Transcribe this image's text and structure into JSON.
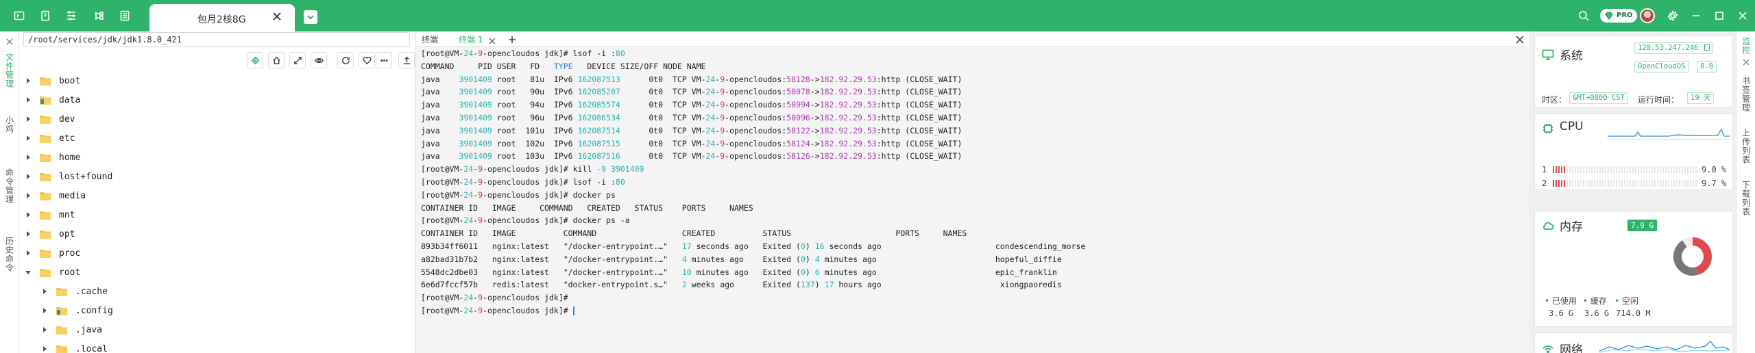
{
  "topbar": {
    "left_icons": [
      "terminal-icon",
      "file-icon",
      "network-icon",
      "tree-icon",
      "list-icon"
    ],
    "active_tab": "包月2核8G",
    "pro_label": "PRO",
    "right_icons": [
      "search-icon",
      "settings-icon",
      "minimize-icon",
      "maximize-icon",
      "close-icon"
    ]
  },
  "left_tabs": [
    "文件管理",
    "小鸡",
    "命令管理",
    "历史命令"
  ],
  "file_panel": {
    "path": "/root/services/jdk/jdk1.8.0_421",
    "toolbar_icons": [
      "locate-icon",
      "home-icon",
      "expand-icon",
      "eye-icon",
      "refresh-icon",
      "heart-icon",
      "more-icon",
      "upload-icon"
    ],
    "tree": [
      {
        "name": "boot",
        "level": 0,
        "expanded": false,
        "special": false
      },
      {
        "name": "data",
        "level": 0,
        "expanded": false,
        "special": true
      },
      {
        "name": "dev",
        "level": 0,
        "expanded": false,
        "special": false
      },
      {
        "name": "etc",
        "level": 0,
        "expanded": false,
        "special": false
      },
      {
        "name": "home",
        "level": 0,
        "expanded": false,
        "special": false
      },
      {
        "name": "lost+found",
        "level": 0,
        "expanded": false,
        "special": false
      },
      {
        "name": "media",
        "level": 0,
        "expanded": false,
        "special": false
      },
      {
        "name": "mnt",
        "level": 0,
        "expanded": false,
        "special": false
      },
      {
        "name": "opt",
        "level": 0,
        "expanded": false,
        "special": false
      },
      {
        "name": "proc",
        "level": 0,
        "expanded": false,
        "special": false
      },
      {
        "name": "root",
        "level": 0,
        "expanded": true,
        "special": false
      },
      {
        "name": ".cache",
        "level": 1,
        "expanded": false,
        "special": false
      },
      {
        "name": ".config",
        "level": 1,
        "expanded": false,
        "special": true
      },
      {
        "name": ".java",
        "level": 1,
        "expanded": false,
        "special": false
      },
      {
        "name": ".local",
        "level": 1,
        "expanded": false,
        "special": false
      }
    ]
  },
  "terminal": {
    "tabs": [
      {
        "label": "终端",
        "active": false
      },
      {
        "label": "终端 1",
        "active": true
      }
    ],
    "lines": [
      [
        [
          "[root@VM-",
          ""
        ],
        [
          "24",
          "num"
        ],
        [
          "-",
          ""
        ],
        [
          "9",
          "red"
        ],
        [
          "-opencloudos jdk]# lsof -i :",
          ""
        ],
        [
          "80",
          "num"
        ]
      ],
      [
        [
          "COMMAND     PID USER   FD   ",
          ""
        ],
        [
          "TYPE",
          "hdr"
        ],
        [
          "   DEVICE SIZE/OFF NODE NAME",
          ""
        ]
      ],
      [
        [
          "java    ",
          ""
        ],
        [
          "3901409",
          "num"
        ],
        [
          " root   81u  IPv6 ",
          ""
        ],
        [
          "162087513",
          "num"
        ],
        [
          "      0t0  TCP VM-",
          ""
        ],
        [
          "24",
          "num"
        ],
        [
          "-",
          ""
        ],
        [
          "9",
          "red"
        ],
        [
          "-opencloudos:",
          ""
        ],
        [
          "58128",
          "ip"
        ],
        [
          "->",
          ""
        ],
        [
          "182.92.29.53",
          "ip"
        ],
        [
          ":http (CLOSE_WAIT)",
          ""
        ]
      ],
      [
        [
          "java    ",
          ""
        ],
        [
          "3901409",
          "num"
        ],
        [
          " root   90u  IPv6 ",
          ""
        ],
        [
          "162085287",
          "num"
        ],
        [
          "      0t0  TCP VM-",
          ""
        ],
        [
          "24",
          "num"
        ],
        [
          "-",
          ""
        ],
        [
          "9",
          "red"
        ],
        [
          "-opencloudos:",
          ""
        ],
        [
          "58078",
          "ip"
        ],
        [
          "->",
          ""
        ],
        [
          "182.92.29.53",
          "ip"
        ],
        [
          ":http (CLOSE_WAIT)",
          ""
        ]
      ],
      [
        [
          "java    ",
          ""
        ],
        [
          "3901409",
          "num"
        ],
        [
          " root   94u  IPv6 ",
          ""
        ],
        [
          "162085574",
          "num"
        ],
        [
          "      0t0  TCP VM-",
          ""
        ],
        [
          "24",
          "num"
        ],
        [
          "-",
          ""
        ],
        [
          "9",
          "red"
        ],
        [
          "-opencloudos:",
          ""
        ],
        [
          "58094",
          "ip"
        ],
        [
          "->",
          ""
        ],
        [
          "182.92.29.53",
          "ip"
        ],
        [
          ":http (CLOSE_WAIT)",
          ""
        ]
      ],
      [
        [
          "java    ",
          ""
        ],
        [
          "3901409",
          "num"
        ],
        [
          " root   96u  IPv6 ",
          ""
        ],
        [
          "162086534",
          "num"
        ],
        [
          "      0t0  TCP VM-",
          ""
        ],
        [
          "24",
          "num"
        ],
        [
          "-",
          ""
        ],
        [
          "9",
          "red"
        ],
        [
          "-opencloudos:",
          ""
        ],
        [
          "58096",
          "ip"
        ],
        [
          "->",
          ""
        ],
        [
          "182.92.29.53",
          "ip"
        ],
        [
          ":http (CLOSE_WAIT)",
          ""
        ]
      ],
      [
        [
          "java    ",
          ""
        ],
        [
          "3901409",
          "num"
        ],
        [
          " root  101u  IPv6 ",
          ""
        ],
        [
          "162087514",
          "num"
        ],
        [
          "      0t0  TCP VM-",
          ""
        ],
        [
          "24",
          "num"
        ],
        [
          "-",
          ""
        ],
        [
          "9",
          "red"
        ],
        [
          "-opencloudos:",
          ""
        ],
        [
          "58122",
          "ip"
        ],
        [
          "->",
          ""
        ],
        [
          "182.92.29.53",
          "ip"
        ],
        [
          ":http (CLOSE_WAIT)",
          ""
        ]
      ],
      [
        [
          "java    ",
          ""
        ],
        [
          "3901409",
          "num"
        ],
        [
          " root  102u  IPv6 ",
          ""
        ],
        [
          "162087515",
          "num"
        ],
        [
          "      0t0  TCP VM-",
          ""
        ],
        [
          "24",
          "num"
        ],
        [
          "-",
          ""
        ],
        [
          "9",
          "red"
        ],
        [
          "-opencloudos:",
          ""
        ],
        [
          "58124",
          "ip"
        ],
        [
          "->",
          ""
        ],
        [
          "182.92.29.53",
          "ip"
        ],
        [
          ":http (CLOSE_WAIT)",
          ""
        ]
      ],
      [
        [
          "java    ",
          ""
        ],
        [
          "3901409",
          "num"
        ],
        [
          " root  103u  IPv6 ",
          ""
        ],
        [
          "162087516",
          "num"
        ],
        [
          "      0t0  TCP VM-",
          ""
        ],
        [
          "24",
          "num"
        ],
        [
          "-",
          ""
        ],
        [
          "9",
          "red"
        ],
        [
          "-opencloudos:",
          ""
        ],
        [
          "58126",
          "ip"
        ],
        [
          "->",
          ""
        ],
        [
          "182.92.29.53",
          "ip"
        ],
        [
          ":http (CLOSE_WAIT)",
          ""
        ]
      ],
      [
        [
          "[root@VM-",
          ""
        ],
        [
          "24",
          "num"
        ],
        [
          "-",
          ""
        ],
        [
          "9",
          "red"
        ],
        [
          "-opencloudos jdk]# kill ",
          ""
        ],
        [
          "-9",
          "num"
        ],
        [
          " ",
          ""
        ],
        [
          "3901409",
          "num"
        ]
      ],
      [
        [
          "[root@VM-",
          ""
        ],
        [
          "24",
          "num"
        ],
        [
          "-",
          ""
        ],
        [
          "9",
          "red"
        ],
        [
          "-opencloudos jdk]# lsof -i :",
          ""
        ],
        [
          "80",
          "num"
        ]
      ],
      [
        [
          "[root@VM-",
          ""
        ],
        [
          "24",
          "num"
        ],
        [
          "-",
          ""
        ],
        [
          "9",
          "red"
        ],
        [
          "-opencloudos jdk]# docker ps",
          ""
        ]
      ],
      [
        [
          "CONTAINER ID   IMAGE     COMMAND   CREATED   STATUS    PORTS     NAMES",
          ""
        ]
      ],
      [
        [
          "[root@VM-",
          ""
        ],
        [
          "24",
          "num"
        ],
        [
          "-",
          ""
        ],
        [
          "9",
          "red"
        ],
        [
          "-opencloudos jdk]# docker ps -a",
          ""
        ]
      ],
      [
        [
          "CONTAINER ID   IMAGE          COMMAND                  CREATED          STATUS                      PORTS     NAMES",
          ""
        ]
      ],
      [
        [
          "893b34ff6011   nginx:latest   \"/docker-entrypoint.…\"   ",
          ""
        ],
        [
          "17",
          "num"
        ],
        [
          " seconds ago   Exited (",
          ""
        ],
        [
          "0",
          "num"
        ],
        [
          ") ",
          ""
        ],
        [
          "16",
          "num"
        ],
        [
          " seconds ago                        condescending_morse",
          ""
        ]
      ],
      [
        [
          "a82bad31b7b2   nginx:latest   \"/docker-entrypoint.…\"   ",
          ""
        ],
        [
          "4",
          "num"
        ],
        [
          " minutes ago    Exited (",
          ""
        ],
        [
          "0",
          "num"
        ],
        [
          ") ",
          ""
        ],
        [
          "4",
          "num"
        ],
        [
          " minutes ago                         hopeful_diffie",
          ""
        ]
      ],
      [
        [
          "5548dc2dbe03   nginx:latest   \"/docker-entrypoint.…\"   ",
          ""
        ],
        [
          "10",
          "num"
        ],
        [
          " minutes ago   Exited (",
          ""
        ],
        [
          "0",
          "num"
        ],
        [
          ") ",
          ""
        ],
        [
          "6",
          "num"
        ],
        [
          " minutes ago                         epic_franklin",
          ""
        ]
      ],
      [
        [
          "6e6d7fccf57b   redis:latest   \"docker-entrypoint.s…\"   ",
          ""
        ],
        [
          "2",
          "num"
        ],
        [
          " weeks ago      Exited (",
          ""
        ],
        [
          "137",
          "num"
        ],
        [
          ") ",
          ""
        ],
        [
          "17",
          "num"
        ],
        [
          " hours ago                         xiongpaoredis",
          ""
        ]
      ],
      [
        [
          "[root@VM-",
          ""
        ],
        [
          "24",
          "num"
        ],
        [
          "-",
          ""
        ],
        [
          "9",
          "red"
        ],
        [
          "-opencloudos jdk]#",
          ""
        ]
      ],
      [
        [
          "[root@VM-",
          ""
        ],
        [
          "24",
          "num"
        ],
        [
          "-",
          ""
        ],
        [
          "9",
          "red"
        ],
        [
          "-opencloudos jdk]# ",
          ""
        ]
      ]
    ],
    "add_icon": "plus-icon",
    "close_icon": "close-icon"
  },
  "monitor": {
    "system": {
      "title": "系统",
      "ip": "120.53.247.246",
      "os": "OpenCloudOS",
      "os_version": "8.8",
      "timezone_label": "时区：",
      "timezone": "GMT+0800  CST",
      "uptime_label": "运行时间：",
      "uptime": "19 天"
    },
    "cpu": {
      "title": "CPU",
      "cores": [
        {
          "index": "1",
          "value": "9.0 %",
          "fraction": 0.09
        },
        {
          "index": "2",
          "value": "9.7 %",
          "fraction": 0.097
        }
      ]
    },
    "memory": {
      "title": "内存",
      "total": "7.9 G",
      "used_label": "已使用",
      "cache_label": "缓存",
      "free_label": "空闲",
      "used": "3.6 G",
      "cache": "3.6 G",
      "free": "714.0 M",
      "used_fraction": 0.455,
      "cache_fraction": 0.455
    },
    "network": {
      "title": "网络"
    },
    "colors": {
      "accent": "#2db36a",
      "used": "#e04a4a",
      "cache": "#777777"
    }
  },
  "right_tabs": [
    "监控",
    "书签管理",
    "上传列表",
    "下载列表"
  ]
}
